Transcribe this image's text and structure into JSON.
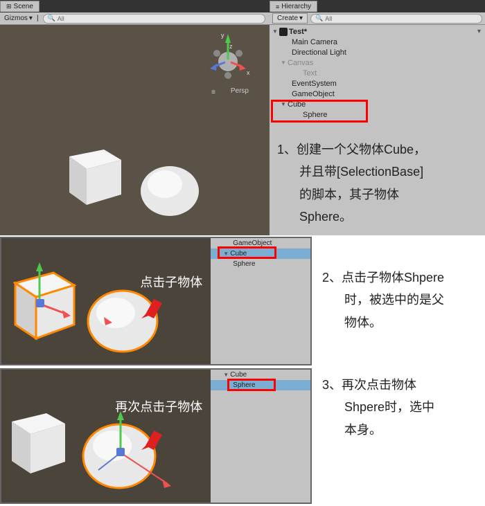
{
  "scene": {
    "tab": "Scene",
    "gizmos": "Gizmos",
    "search_placeholder": "All",
    "persp": "Persp"
  },
  "hierarchy": {
    "tab": "Hierarchy",
    "create": "Create",
    "search_placeholder": "All",
    "root": "Test*",
    "items": {
      "main_camera": "Main Camera",
      "directional_light": "Directional Light",
      "canvas": "Canvas",
      "text": "Text",
      "event_system": "EventSystem",
      "game_object": "GameObject",
      "cube": "Cube",
      "sphere": "Sphere"
    }
  },
  "axis": {
    "x": "x",
    "y": "y",
    "z": "z"
  },
  "annotations": {
    "a1_l1": "1、创建一个父物体Cube，",
    "a1_l2": "并且带[SelectionBase]",
    "a1_l3": "的脚本，其子物体",
    "a1_l4": "Sphere。",
    "a2_l1": "2、点击子物体Shpere",
    "a2_l2": "时，被选中的是父",
    "a2_l3": "物体。",
    "a3_l1": "3、再次点击物体",
    "a3_l2": "Shpere时，选中",
    "a3_l3": "本身。",
    "mid_label": "点击子物体",
    "bot_label": "再次点击子物体"
  },
  "mini_hier": {
    "game_object": "GameObject",
    "cube": "Cube",
    "sphere": "Sphere"
  }
}
